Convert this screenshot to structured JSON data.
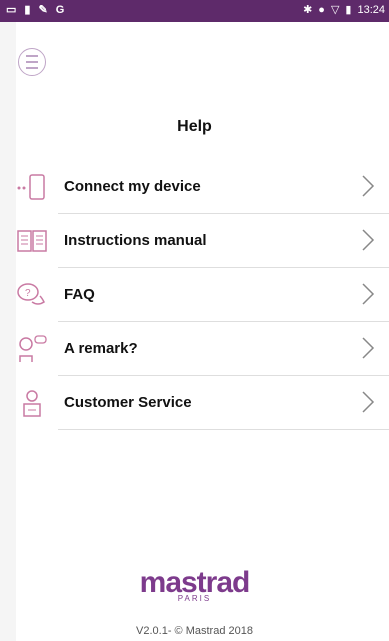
{
  "status_bar": {
    "time": "13:24",
    "left_icons": [
      "mail-icon",
      "battery-icon",
      "wrench-icon",
      "g-icon"
    ],
    "left_g": "G",
    "right_icons": [
      "bluetooth-icon",
      "signal-icon",
      "wifi-icon",
      "battery-icon"
    ]
  },
  "header": {
    "menu_icon": "hamburger-menu-icon",
    "title": "Help"
  },
  "items": [
    {
      "label": "Connect my device",
      "icon": "phone-device-icon"
    },
    {
      "label": "Instructions manual",
      "icon": "book-icon"
    },
    {
      "label": "FAQ",
      "icon": "chat-bubbles-icon"
    },
    {
      "label": "A remark?",
      "icon": "chef-remark-icon"
    },
    {
      "label": "Customer Service",
      "icon": "service-person-icon"
    }
  ],
  "footer": {
    "logo": "mastrad",
    "logo_sub": "PARIS",
    "version": "V2.0.1- © Mastrad 2018"
  },
  "colors": {
    "status_bar": "#5e2a6a",
    "brand_purple": "#7d3b8c",
    "icon_pink": "#c97aa3"
  }
}
